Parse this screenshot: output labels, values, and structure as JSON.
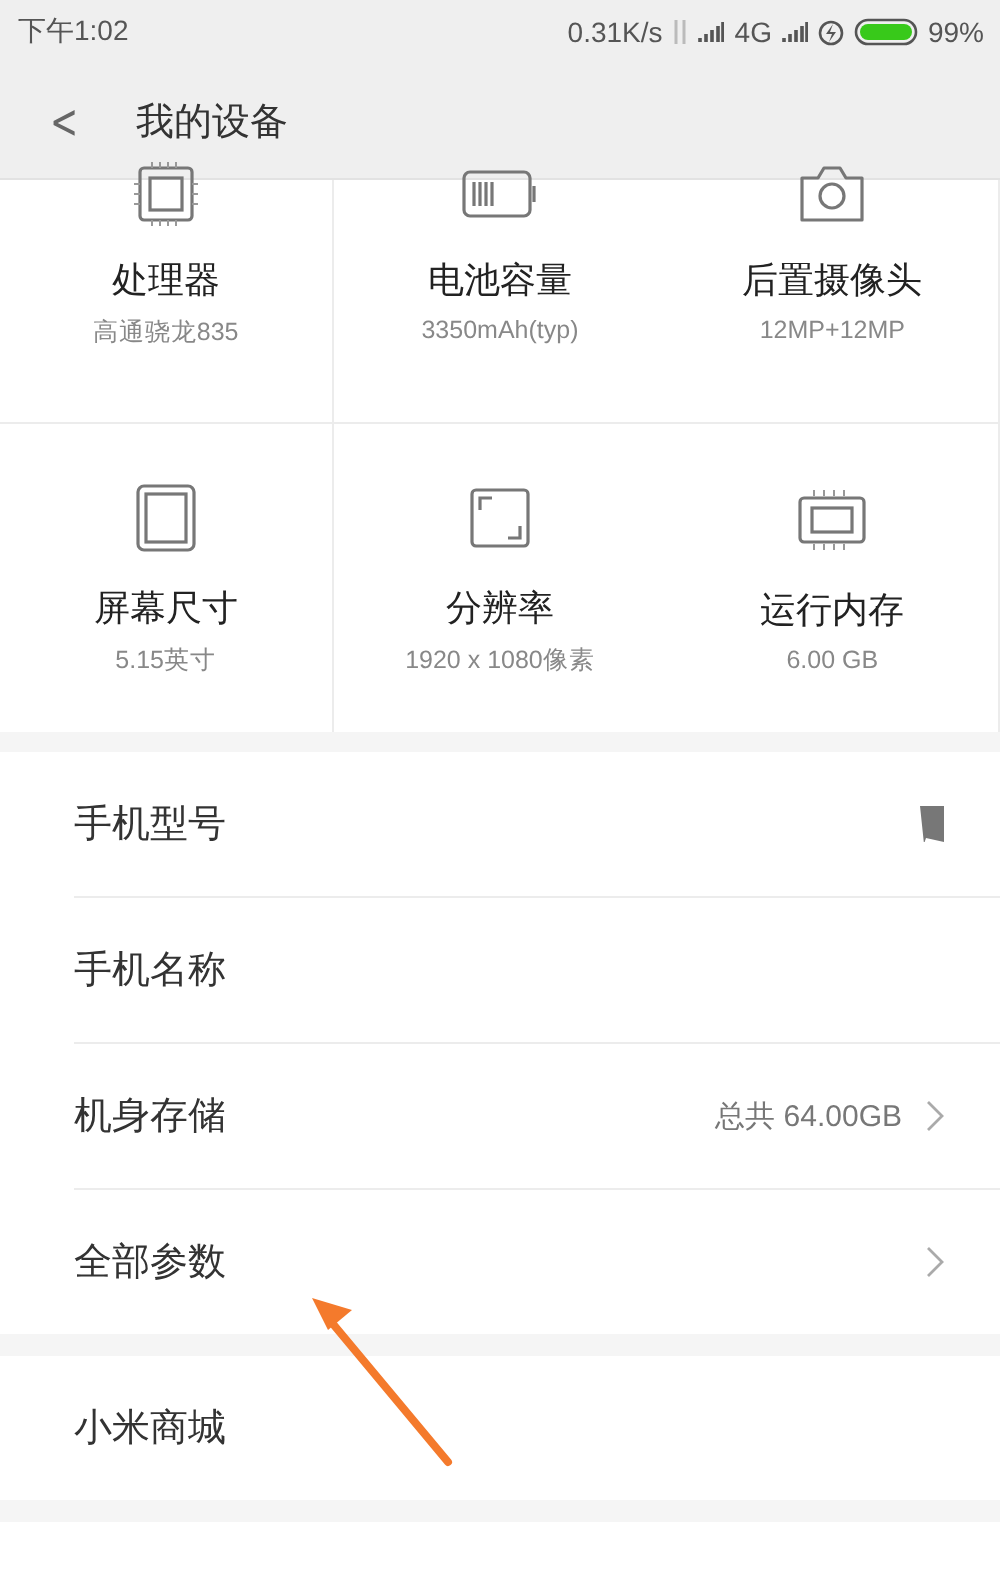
{
  "status_bar": {
    "time": "下午1:02",
    "net_speed": "0.31K/s",
    "network": "4G",
    "battery": "99%"
  },
  "header": {
    "back": "<",
    "title": "我的设备"
  },
  "specs": [
    {
      "kind": "cpu",
      "title": "处理器",
      "value": "高通骁龙835"
    },
    {
      "kind": "battery",
      "title": "电池容量",
      "value": "3350mAh(typ)"
    },
    {
      "kind": "camera",
      "title": "后置摄像头",
      "value": "12MP+12MP"
    },
    {
      "kind": "screen",
      "title": "屏幕尺寸",
      "value": "5.15英寸"
    },
    {
      "kind": "resolution",
      "title": "分辨率",
      "value": "1920 x 1080像素"
    },
    {
      "kind": "memory",
      "title": "运行内存",
      "value": "6.00 GB"
    }
  ],
  "sections": [
    [
      {
        "kind": "redacted",
        "label": "手机型号"
      },
      {
        "kind": "plain",
        "label": "手机名称"
      },
      {
        "kind": "chevron",
        "label": "机身存储",
        "value": "总共 64.00GB"
      },
      {
        "kind": "chevron",
        "label": "全部参数"
      }
    ],
    [
      {
        "kind": "plain",
        "label": "小米商城"
      }
    ],
    [
      {
        "kind": "blank"
      }
    ]
  ],
  "annotation": {
    "kind": "arrow"
  }
}
